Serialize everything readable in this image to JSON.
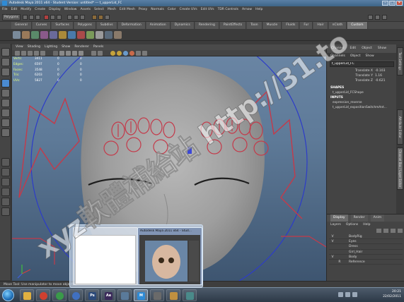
{
  "window": {
    "title": "Autodesk Maya 2011 x64 - Student Version: untitled*  ---  t_upperLid_FC",
    "buttons": [
      "–",
      "□",
      "✕"
    ]
  },
  "menubar": {
    "items": [
      "File",
      "Edit",
      "Modify",
      "Create",
      "Display",
      "Window",
      "Assets",
      "Select",
      "Mesh",
      "Edit Mesh",
      "Proxy",
      "Normals",
      "Color",
      "Create UVs",
      "Edit UVs",
      "TDR Controls",
      "Arnow",
      "Help"
    ]
  },
  "statusline": {
    "mode": "Polygons"
  },
  "shelf": {
    "tabs": [
      "General",
      "Curves",
      "Surfaces",
      "Polygons",
      "Subdivs",
      "Deformation",
      "Animation",
      "Dynamics",
      "Rendering",
      "PaintEffects",
      "Toon",
      "Muscle",
      "Fluids",
      "Fur",
      "Hair",
      "nCloth",
      "Custom"
    ],
    "active_tab": "Custom"
  },
  "panel": {
    "menus": [
      "View",
      "Shading",
      "Lighting",
      "Show",
      "Renderer",
      "Panels"
    ]
  },
  "hud": {
    "rows": [
      {
        "label": "Verts:",
        "v1": "3411",
        "v2": "0",
        "v3": "0"
      },
      {
        "label": "Edges:",
        "v1": "6597",
        "v2": "0",
        "v3": "0"
      },
      {
        "label": "Faces:",
        "v1": "3548",
        "v2": "0",
        "v3": "0"
      },
      {
        "label": "Tris:",
        "v1": "6203",
        "v2": "0",
        "v3": "0"
      },
      {
        "label": "UVs:",
        "v1": "5827",
        "v2": "0",
        "v3": "0"
      }
    ]
  },
  "channel_box": {
    "tabs": [
      "Channel",
      "Edit",
      "Object",
      "Show"
    ],
    "bar": [
      "Channels",
      "Object",
      "Show"
    ],
    "object": "t_upperLid_FC",
    "attributes": [
      {
        "name": "Translate X",
        "value": "-0.103"
      },
      {
        "name": "Translate Y",
        "value": "1.16"
      },
      {
        "name": "Translate Z",
        "value": "-0.621"
      }
    ],
    "shapes_head": "SHAPES",
    "shape": "t_upperLid_FCShape",
    "inputs_head": "INPUTS",
    "inputs": [
      "expression_reverse",
      "t_upperLid_expositionSwitchmAnt..."
    ]
  },
  "side_tabs": [
    "Tool Settings",
    "Attribute Editor",
    "Channel Box / Layer Editor"
  ],
  "layer_editor": {
    "tabs": [
      "Display",
      "Render",
      "Anim"
    ],
    "active_tab": "Display",
    "menu": [
      "Layers",
      "Options",
      "Help"
    ],
    "layers": [
      {
        "v": "V",
        "p": "",
        "name": "BodyRig"
      },
      {
        "v": "V",
        "p": "",
        "name": "Eyes"
      },
      {
        "v": "",
        "p": "",
        "name": "Dress"
      },
      {
        "v": "",
        "p": "",
        "name": "Girl_Hair"
      },
      {
        "v": "V",
        "p": "",
        "name": "Body"
      },
      {
        "v": "",
        "p": "R",
        "name": "Reference"
      }
    ]
  },
  "helpline": {
    "text": "Move Tool: Use manipulator to move object(s)."
  },
  "taskbar": {
    "thumbs": [
      {
        "title": "Autodesk Maya 2011 x64 - Stud..."
      }
    ],
    "clock_time": "20:21",
    "clock_date": "22/02/2011",
    "colors": {
      "accent": "#2f8bd6"
    }
  },
  "watermark": "xyz軟體補給站 http://31.to"
}
